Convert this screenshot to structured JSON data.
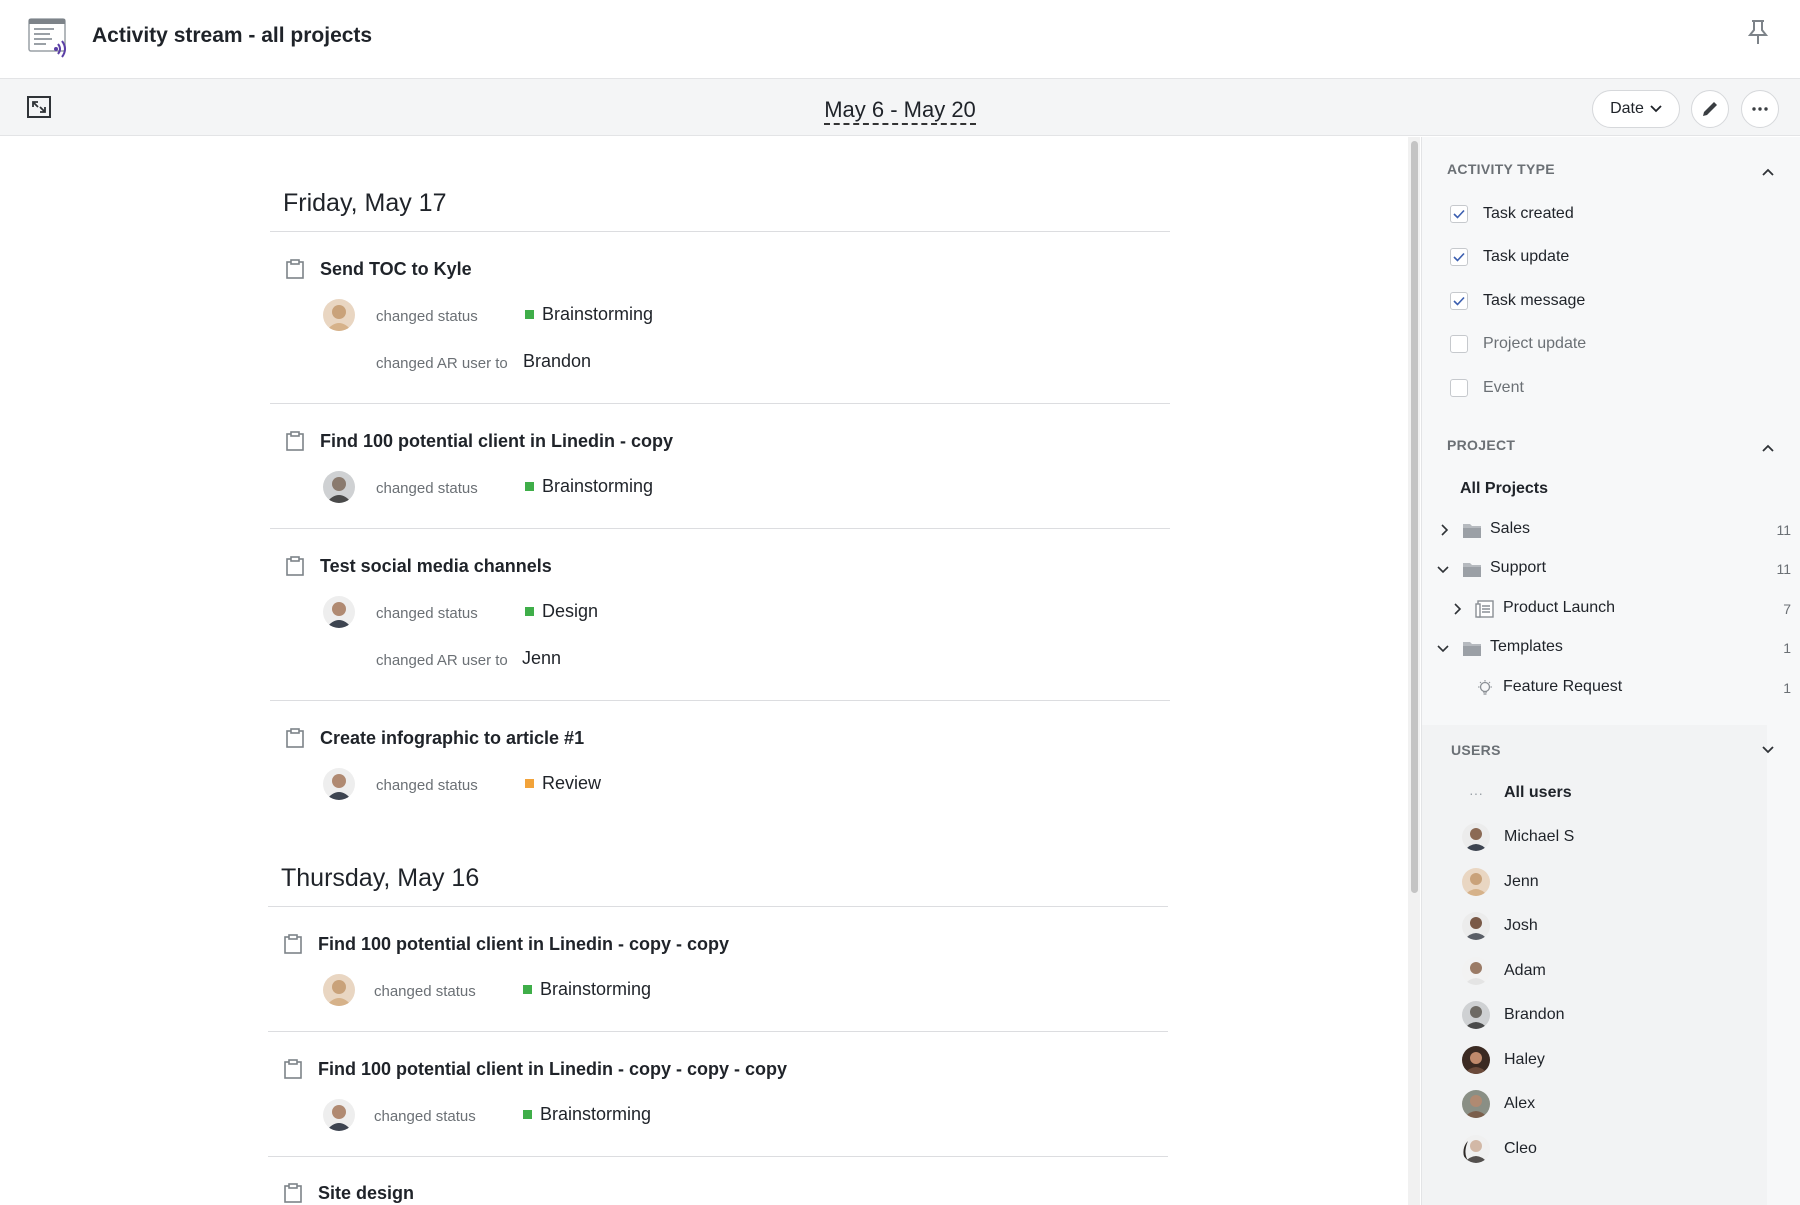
{
  "app": {
    "title": "Activity stream - all projects",
    "icon": "activity-stream-icon"
  },
  "toolbar": {
    "date_range": "May 6 - May 20",
    "sort_label": "Date"
  },
  "feed": {
    "days": [
      {
        "heading": "Friday, May 17",
        "entries": [
          {
            "title": "Send TOC to Kyle",
            "changes": [
              {
                "label": "changed status",
                "value": "Brainstorming",
                "status_color": "#3fae49",
                "avatar": "Jenn"
              },
              {
                "label": "changed AR user to",
                "value": "Brandon"
              }
            ]
          },
          {
            "title": "Find 100 potential client in Linedin - copy",
            "changes": [
              {
                "label": "changed status",
                "value": "Brainstorming",
                "status_color": "#3fae49",
                "avatar": "Brandon"
              }
            ]
          },
          {
            "title": "Test social media channels",
            "changes": [
              {
                "label": "changed status",
                "value": "Design",
                "status_color": "#3fae49",
                "avatar": "Michael S"
              },
              {
                "label": "changed AR user to",
                "value": "Jenn"
              }
            ]
          },
          {
            "title": "Create infographic to article #1",
            "changes": [
              {
                "label": "changed status",
                "value": "Review",
                "status_color": "#f2a33a",
                "avatar": "Michael S"
              }
            ]
          }
        ]
      },
      {
        "heading": "Thursday, May 16",
        "entries": [
          {
            "title": "Find 100 potential client in Linedin - copy - copy",
            "changes": [
              {
                "label": "changed status",
                "value": "Brainstorming",
                "status_color": "#3fae49",
                "avatar": "Jenn"
              }
            ]
          },
          {
            "title": "Find 100 potential client in Linedin - copy - copy - copy",
            "changes": [
              {
                "label": "changed status",
                "value": "Brainstorming",
                "status_color": "#3fae49",
                "avatar": "Michael S"
              }
            ]
          },
          {
            "title": "Site design",
            "changes": []
          }
        ]
      }
    ]
  },
  "panel": {
    "activity_type": {
      "title": "ACTIVITY TYPE",
      "options": [
        {
          "label": "Task created",
          "checked": true
        },
        {
          "label": "Task update",
          "checked": true
        },
        {
          "label": "Task message",
          "checked": true
        },
        {
          "label": "Project update",
          "checked": false
        },
        {
          "label": "Event",
          "checked": false
        }
      ]
    },
    "project": {
      "title": "PROJECT",
      "all_label": "All Projects",
      "items": [
        {
          "label": "Sales",
          "count": "11",
          "icon": "folder-icon",
          "arrow": "chevron-right"
        },
        {
          "label": "Support",
          "count": "11",
          "icon": "folder-icon",
          "arrow": "chevron-down"
        },
        {
          "label": "Product Launch",
          "count": "7",
          "icon": "project-list-icon",
          "arrow": "chevron-right"
        },
        {
          "label": "Templates",
          "count": "1",
          "icon": "folder-icon",
          "arrow": "chevron-down"
        },
        {
          "label": "Feature Request",
          "count": "1",
          "icon": "lightbulb-icon",
          "arrow": ""
        }
      ]
    },
    "users": {
      "title": "USERS",
      "all_label": "All users",
      "items": [
        {
          "name": "Michael S",
          "color": "#8b6a55"
        },
        {
          "name": "Jenn",
          "color": "#c9a27a"
        },
        {
          "name": "Josh",
          "color": "#7a5a48"
        },
        {
          "name": "Adam",
          "color": "#9b7b66"
        },
        {
          "name": "Brandon",
          "color": "#6e6a64"
        },
        {
          "name": "Haley",
          "color": "#6b4a3a"
        },
        {
          "name": "Alex",
          "color": "#7b5f4c"
        },
        {
          "name": "Cleo",
          "color": "#54504e"
        }
      ]
    }
  }
}
